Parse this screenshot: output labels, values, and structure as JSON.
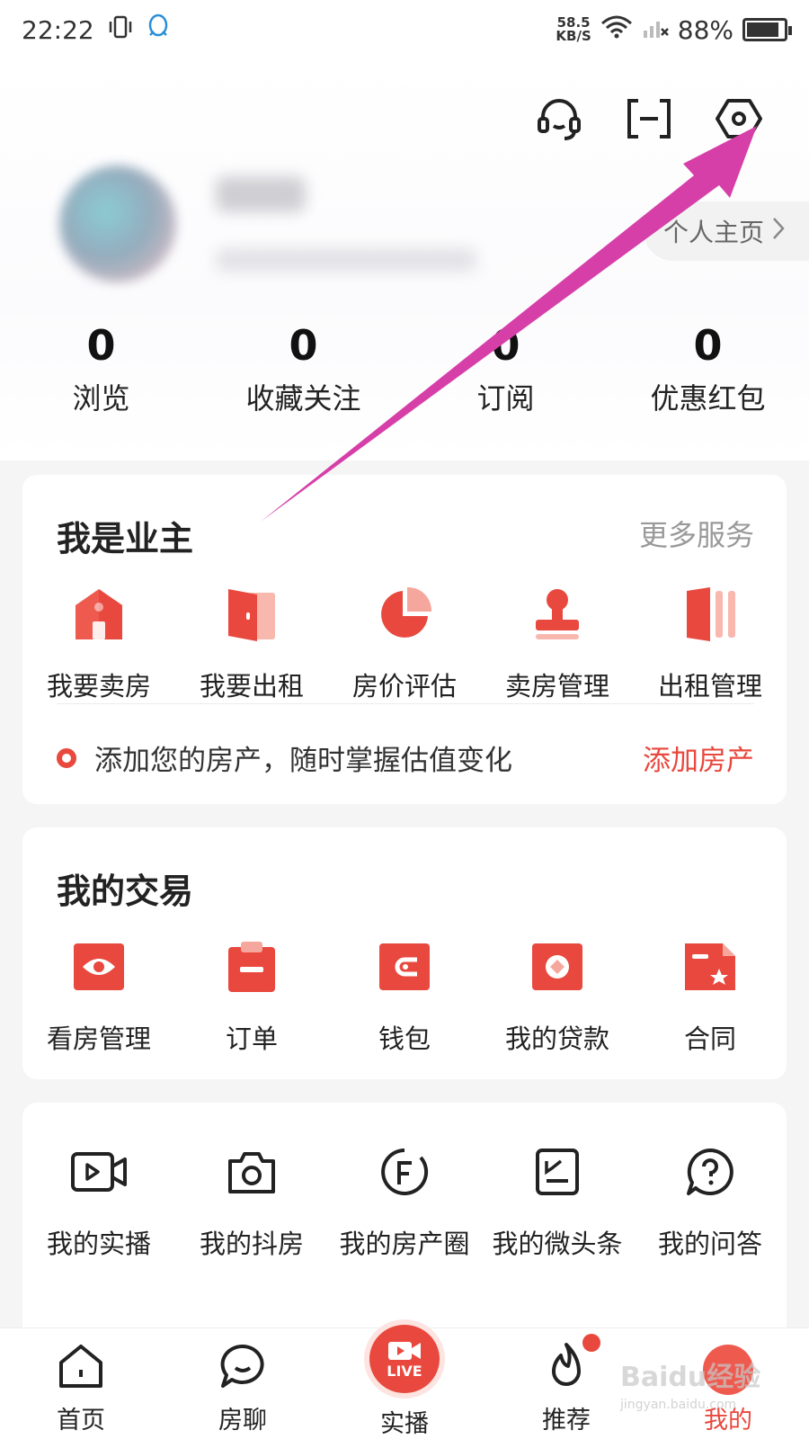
{
  "status_bar": {
    "time": "22:22",
    "speed_value": "58.5",
    "speed_unit": "KB/S",
    "battery": "88%",
    "battery_level": 0.88
  },
  "header": {
    "icons": [
      "headset-icon",
      "scan-icon",
      "settings-icon"
    ],
    "profile_link": "个人主页",
    "stats": [
      {
        "value": "0",
        "label": "浏览"
      },
      {
        "value": "0",
        "label": "收藏关注"
      },
      {
        "value": "0",
        "label": "订阅"
      },
      {
        "value": "0",
        "label": "优惠红包"
      }
    ]
  },
  "owner": {
    "title": "我是业主",
    "more": "更多服务",
    "items": [
      {
        "label": "我要卖房",
        "icon": "house-icon"
      },
      {
        "label": "我要出租",
        "icon": "door-icon"
      },
      {
        "label": "房价评估",
        "icon": "pie-chart-icon"
      },
      {
        "label": "卖房管理",
        "icon": "stamp-icon"
      },
      {
        "label": "出租管理",
        "icon": "books-icon"
      }
    ],
    "tip": "添加您的房产，随时掌握估值变化",
    "tip_action": "添加房产"
  },
  "trade": {
    "title": "我的交易",
    "items": [
      {
        "label": "看房管理",
        "icon": "eye-icon"
      },
      {
        "label": "订单",
        "icon": "clipboard-icon"
      },
      {
        "label": "钱包",
        "icon": "wallet-icon"
      },
      {
        "label": "我的贷款",
        "icon": "loan-icon"
      },
      {
        "label": "合同",
        "icon": "contract-icon"
      }
    ]
  },
  "media": {
    "items": [
      {
        "label": "我的实播",
        "icon": "video-icon"
      },
      {
        "label": "我的抖房",
        "icon": "camera-icon"
      },
      {
        "label": "我的房产圈",
        "icon": "circle-f-icon"
      },
      {
        "label": "我的微头条",
        "icon": "note-icon"
      },
      {
        "label": "我的问答",
        "icon": "question-icon"
      }
    ]
  },
  "nav": {
    "items": [
      {
        "label": "首页",
        "icon": "home-icon"
      },
      {
        "label": "房聊",
        "icon": "chat-icon"
      },
      {
        "label": "实播",
        "icon": "live-icon",
        "badge": "LIVE"
      },
      {
        "label": "推荐",
        "icon": "flame-icon"
      },
      {
        "label": "我的",
        "icon": "me-icon"
      }
    ]
  },
  "watermark": {
    "brand": "Baidu经验",
    "url": "jingyan.baidu.com"
  },
  "colors": {
    "accent": "#e8483d",
    "arrow": "#d63fa8"
  }
}
